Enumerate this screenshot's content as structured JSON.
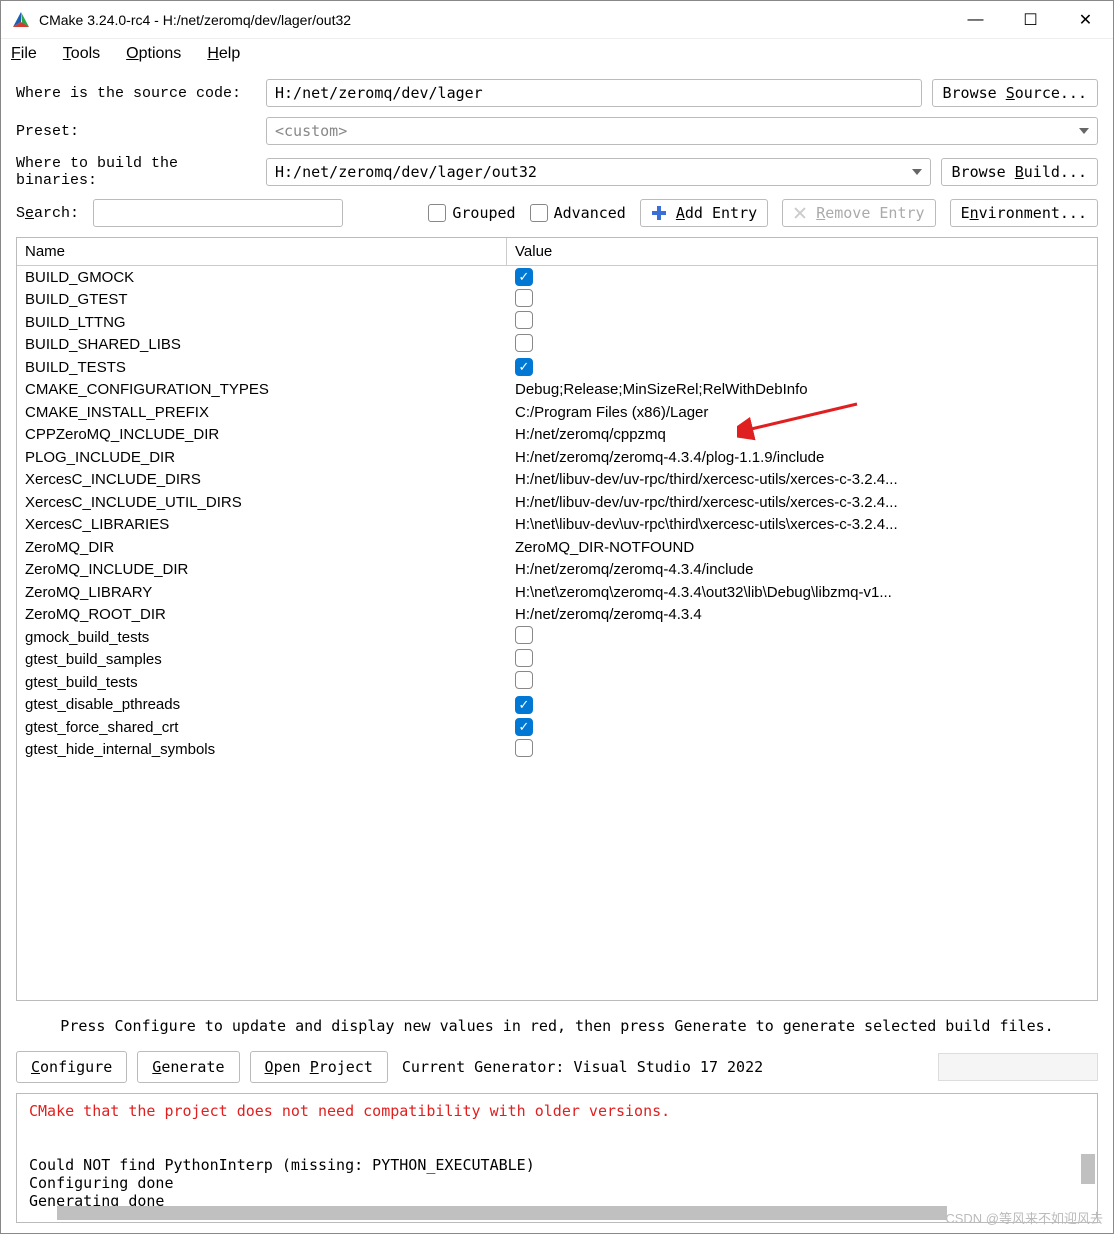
{
  "window": {
    "title": "CMake 3.24.0-rc4 - H:/net/zeromq/dev/lager/out32"
  },
  "menubar": [
    "File",
    "Tools",
    "Options",
    "Help"
  ],
  "labels": {
    "source": "Where is the source code:",
    "preset": "Preset:",
    "build": "Where to build the binaries:",
    "search": "Search:",
    "grouped": "Grouped",
    "advanced": "Advanced"
  },
  "inputs": {
    "source": "H:/net/zeromq/dev/lager",
    "preset": "<custom>",
    "build": "H:/net/zeromq/dev/lager/out32"
  },
  "buttons": {
    "browse_source": "Browse Source...",
    "browse_build": "Browse Build...",
    "add_entry": "Add Entry",
    "remove_entry": "Remove Entry",
    "environment": "Environment...",
    "configure": "Configure",
    "generate": "Generate",
    "open_project": "Open Project"
  },
  "table": {
    "headers": {
      "name": "Name",
      "value": "Value"
    },
    "rows": [
      {
        "name": "BUILD_GMOCK",
        "type": "check",
        "checked": true
      },
      {
        "name": "BUILD_GTEST",
        "type": "check",
        "checked": false
      },
      {
        "name": "BUILD_LTTNG",
        "type": "check",
        "checked": false
      },
      {
        "name": "BUILD_SHARED_LIBS",
        "type": "check",
        "checked": false
      },
      {
        "name": "BUILD_TESTS",
        "type": "check",
        "checked": true
      },
      {
        "name": "CMAKE_CONFIGURATION_TYPES",
        "type": "text",
        "value": "Debug;Release;MinSizeRel;RelWithDebInfo"
      },
      {
        "name": "CMAKE_INSTALL_PREFIX",
        "type": "text",
        "value": "C:/Program Files (x86)/Lager"
      },
      {
        "name": "CPPZeroMQ_INCLUDE_DIR",
        "type": "text",
        "value": "H:/net/zeromq/cppzmq"
      },
      {
        "name": "PLOG_INCLUDE_DIR",
        "type": "text",
        "value": "H:/net/zeromq/zeromq-4.3.4/plog-1.1.9/include"
      },
      {
        "name": "XercesC_INCLUDE_DIRS",
        "type": "text",
        "value": "H:/net/libuv-dev/uv-rpc/third/xercesc-utils/xerces-c-3.2.4..."
      },
      {
        "name": "XercesC_INCLUDE_UTIL_DIRS",
        "type": "text",
        "value": "H:/net/libuv-dev/uv-rpc/third/xercesc-utils/xerces-c-3.2.4..."
      },
      {
        "name": "XercesC_LIBRARIES",
        "type": "text",
        "value": "H:\\net\\libuv-dev\\uv-rpc\\third\\xercesc-utils\\xerces-c-3.2.4..."
      },
      {
        "name": "ZeroMQ_DIR",
        "type": "text",
        "value": "ZeroMQ_DIR-NOTFOUND"
      },
      {
        "name": "ZeroMQ_INCLUDE_DIR",
        "type": "text",
        "value": "H:/net/zeromq/zeromq-4.3.4/include"
      },
      {
        "name": "ZeroMQ_LIBRARY",
        "type": "text",
        "value": "H:\\net\\zeromq\\zeromq-4.3.4\\out32\\lib\\Debug\\libzmq-v1..."
      },
      {
        "name": "ZeroMQ_ROOT_DIR",
        "type": "text",
        "value": "H:/net/zeromq/zeromq-4.3.4"
      },
      {
        "name": "gmock_build_tests",
        "type": "check",
        "checked": false
      },
      {
        "name": "gtest_build_samples",
        "type": "check",
        "checked": false
      },
      {
        "name": "gtest_build_tests",
        "type": "check",
        "checked": false
      },
      {
        "name": "gtest_disable_pthreads",
        "type": "check",
        "checked": true
      },
      {
        "name": "gtest_force_shared_crt",
        "type": "check",
        "checked": true
      },
      {
        "name": "gtest_hide_internal_symbols",
        "type": "check",
        "checked": false
      }
    ]
  },
  "hint": "Press Configure to update and display new values in red, then press Generate to generate selected build files.",
  "generator_label": "Current Generator: Visual Studio 17 2022",
  "output": {
    "red_line": "  CMake that the project does not need compatibility with older versions.",
    "lines": [
      "",
      "",
      "Could NOT find PythonInterp (missing: PYTHON_EXECUTABLE)",
      "Configuring done",
      "Generating done"
    ]
  },
  "watermark": "CSDN @等风来不如迎风去"
}
